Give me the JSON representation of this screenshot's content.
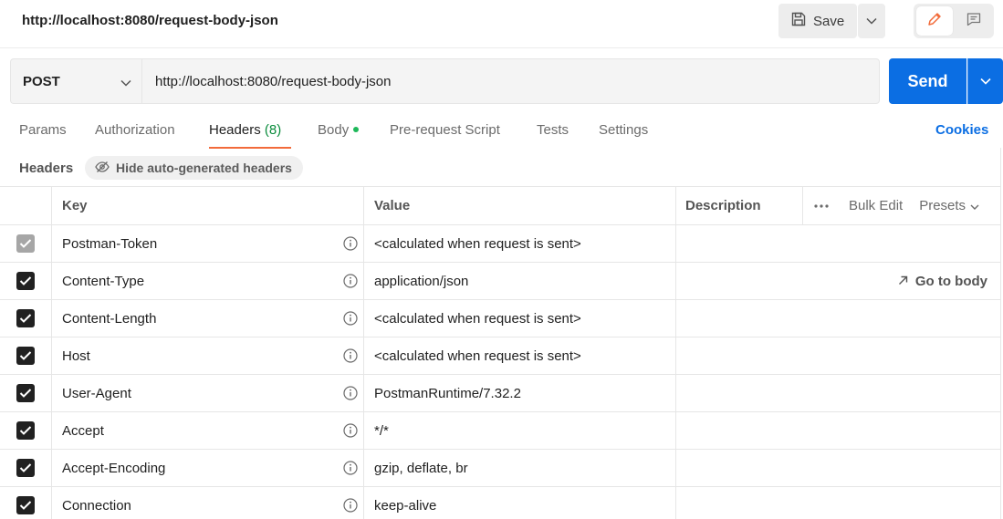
{
  "request": {
    "title": "http://localhost:8080/request-body-json",
    "method": "POST",
    "url": "http://localhost:8080/request-body-json"
  },
  "toolbar": {
    "save_label": "Save",
    "send_label": "Send"
  },
  "tabs": [
    {
      "label": "Params"
    },
    {
      "label": "Authorization"
    },
    {
      "label": "Headers",
      "count": "(8)"
    },
    {
      "label": "Body"
    },
    {
      "label": "Pre-request Script"
    },
    {
      "label": "Tests"
    },
    {
      "label": "Settings"
    }
  ],
  "cookies_label": "Cookies",
  "headers_section": {
    "label": "Headers",
    "hide_label": "Hide auto-generated headers"
  },
  "table": {
    "columns": {
      "key": "Key",
      "value": "Value",
      "description": "Description"
    },
    "bulk_edit": "Bulk Edit",
    "presets": "Presets",
    "go_to_body": "Go to body",
    "rows": [
      {
        "key": "Postman-Token",
        "value": "<calculated when request is sent>"
      },
      {
        "key": "Content-Type",
        "value": "application/json"
      },
      {
        "key": "Content-Length",
        "value": "<calculated when request is sent>"
      },
      {
        "key": "Host",
        "value": "<calculated when request is sent>"
      },
      {
        "key": "User-Agent",
        "value": "PostmanRuntime/7.32.2"
      },
      {
        "key": "Accept",
        "value": "*/*"
      },
      {
        "key": "Accept-Encoding",
        "value": "gzip, deflate, br"
      },
      {
        "key": "Connection",
        "value": "keep-alive"
      }
    ]
  },
  "colors": {
    "accent_blue": "#0b6ee3",
    "active_tab_underline": "#f26b3a",
    "header_count_green": "#0a8c3c"
  }
}
